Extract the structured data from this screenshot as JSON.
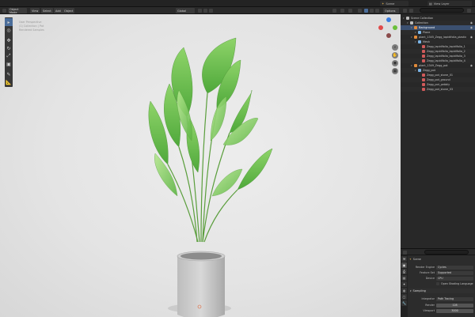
{
  "topbar": {
    "scene_label": "Scene",
    "view_layer_label": "View Layer"
  },
  "viewport_header": {
    "mode": "Object Mode",
    "menus": [
      "View",
      "Select",
      "Add",
      "Object"
    ],
    "transform_orientation": "Global",
    "options_label": "Options"
  },
  "viewport": {
    "info_lines": [
      "User Perspective",
      "(1) Collection | Pot",
      "Rendered Samples"
    ]
  },
  "outliner": {
    "items": [
      {
        "label": "Scene Collection",
        "depth": 0,
        "icon": "collection-icon",
        "color": "#bdbdbd",
        "selected": false
      },
      {
        "label": "Collection",
        "depth": 1,
        "icon": "collection-icon",
        "color": "#bdbdbd",
        "selected": false
      },
      {
        "label": "Background",
        "depth": 2,
        "icon": "object-icon",
        "color": "#e08a3a",
        "selected": true
      },
      {
        "label": "Plane",
        "depth": 3,
        "icon": "mesh-icon",
        "color": "#7bb5e8",
        "selected": false
      },
      {
        "label": "plant_1345_Zegg_lapidifolia_plastic",
        "depth": 2,
        "icon": "object-icon",
        "color": "#e08a3a",
        "selected": false
      },
      {
        "label": "Mesh",
        "depth": 3,
        "icon": "mesh-icon",
        "color": "#7bb5e8",
        "selected": false
      },
      {
        "label": "Zegg_lapidifolia_lapidifolia_1",
        "depth": 4,
        "icon": "material-icon",
        "color": "#d05a5a",
        "selected": false
      },
      {
        "label": "Zegg_lapidifolia_lapidifolia_2",
        "depth": 4,
        "icon": "material-icon",
        "color": "#d05a5a",
        "selected": false
      },
      {
        "label": "Zegg_lapidifolia_lapidifolia_3",
        "depth": 4,
        "icon": "material-icon",
        "color": "#d05a5a",
        "selected": false
      },
      {
        "label": "Zegg_lapidifolia_lapidifolia_4",
        "depth": 4,
        "icon": "material-icon",
        "color": "#d05a5a",
        "selected": false
      },
      {
        "label": "plant_1349_Zegg_pot",
        "depth": 2,
        "icon": "object-icon",
        "color": "#e08a3a",
        "selected": false
      },
      {
        "label": "Zegg_pot",
        "depth": 3,
        "icon": "mesh-icon",
        "color": "#7bb5e8",
        "selected": false
      },
      {
        "label": "Zegg_pot_stone_01",
        "depth": 4,
        "icon": "material-icon",
        "color": "#d05a5a",
        "selected": false
      },
      {
        "label": "Zegg_pot_ground",
        "depth": 4,
        "icon": "material-icon",
        "color": "#d05a5a",
        "selected": false
      },
      {
        "label": "Zegg_pot_pebbly",
        "depth": 4,
        "icon": "material-icon",
        "color": "#d05a5a",
        "selected": false
      },
      {
        "label": "Zegg_pot_stone_03",
        "depth": 4,
        "icon": "material-icon",
        "color": "#d05a5a",
        "selected": false
      }
    ]
  },
  "properties": {
    "breadcrumb": "Scene",
    "render_engine_label": "Render Engine",
    "render_engine_value": "Cycles",
    "feature_set_label": "Feature Set",
    "feature_set_value": "Supported",
    "device_label": "Device",
    "device_value": "CPU",
    "osl_label": "Open Shading Language",
    "sampling_label": "Sampling",
    "integrator_label": "Integrator",
    "integrator_value": "Path Tracing",
    "render_label": "Render",
    "render_value": "128",
    "viewport_label": "Viewport",
    "viewport_value": "3000"
  },
  "colors": {
    "accent_selected": "#3b5070",
    "active_tool": "#4a6d9a",
    "axis_x": "#e04a4a",
    "axis_y": "#6bbf3a",
    "axis_z": "#3a7de0"
  }
}
